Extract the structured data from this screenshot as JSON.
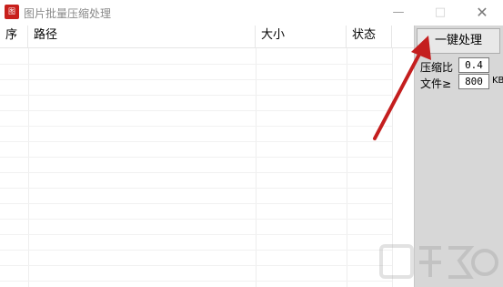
{
  "window": {
    "title": "图片批量压缩处理",
    "app_icon_text": "图",
    "controls": {
      "minimize": "—",
      "maximize": "□",
      "close": "✕"
    }
  },
  "list": {
    "columns": [
      "序",
      "路径",
      "大小",
      "状态"
    ],
    "rows": []
  },
  "panel": {
    "run_button": "一键处理",
    "ratio_label": "压缩比",
    "ratio_value": "0.4",
    "file_label": "文件≥",
    "file_value": "800",
    "file_unit": "KB"
  },
  "colors": {
    "arrow": "#c41e1e",
    "app_icon": "#c8201c",
    "panel_bg": "#d7d7d7"
  }
}
